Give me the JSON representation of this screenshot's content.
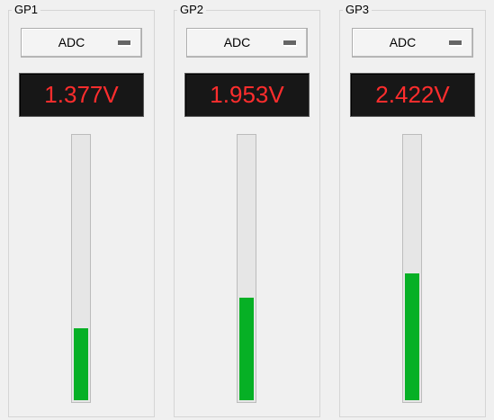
{
  "channels": [
    {
      "title": "GP1",
      "mode": "ADC",
      "reading": "1.377V",
      "level": 0.272
    },
    {
      "title": "GP2",
      "mode": "ADC",
      "reading": "1.953V",
      "level": 0.388
    },
    {
      "title": "GP3",
      "mode": "ADC",
      "reading": "2.422V",
      "level": 0.482
    }
  ],
  "colors": {
    "readout_text": "#ff2d2d",
    "readout_background": "#171717",
    "bar_fill": "#06b025"
  },
  "icons": {
    "dropdown": "dropdown-arrow-icon"
  }
}
